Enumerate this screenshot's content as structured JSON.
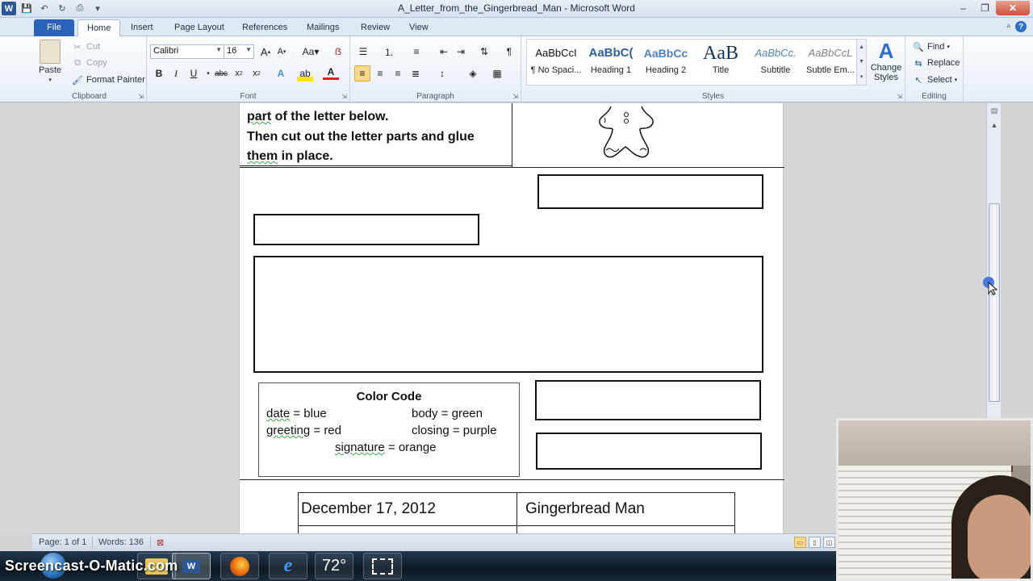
{
  "window": {
    "title": "A_Letter_from_the_Gingerbread_Man  -  Microsoft Word",
    "minimize": "–",
    "restore": "❐",
    "close": "✕"
  },
  "tabs": [
    "File",
    "Home",
    "Insert",
    "Page Layout",
    "References",
    "Mailings",
    "Review",
    "View"
  ],
  "active_tab": "Home",
  "clipboard": {
    "paste": "Paste",
    "cut": "Cut",
    "copy": "Copy",
    "format_painter": "Format Painter",
    "group_label": "Clipboard"
  },
  "font": {
    "name": "Calibri",
    "size": "16",
    "group_label": "Font"
  },
  "paragraph": {
    "group_label": "Paragraph"
  },
  "styles": {
    "items": [
      {
        "sample": "AaBbCcI",
        "name": "¶ No Spaci..."
      },
      {
        "sample": "AaBbC(",
        "name": "Heading 1"
      },
      {
        "sample": "AaBbCc",
        "name": "Heading 2"
      },
      {
        "sample": "AaB",
        "name": "Title"
      },
      {
        "sample": "AaBbCc.",
        "name": "Subtitle"
      },
      {
        "sample": "AaBbCcL",
        "name": "Subtle Em..."
      }
    ],
    "change_styles": "Change Styles",
    "group_label": "Styles"
  },
  "editing": {
    "find": "Find",
    "replace": "Replace",
    "select": "Select",
    "group_label": "Editing"
  },
  "document": {
    "instructions": {
      "line1_word": "part",
      "line1_rest": " of the letter below.",
      "line2": "Then cut out the letter parts and glue",
      "line3_word": "them",
      "line3_rest": " in place."
    },
    "color_code": {
      "title": "Color Code",
      "date_word": "date",
      "date_rest": " = blue",
      "body": "body = green",
      "greeting_word": "greeting",
      "greeting_rest": " = red",
      "closing": "closing = purple",
      "signature_word": "signature",
      "signature_rest": " = orange"
    },
    "table": {
      "date": "December  17, 2012",
      "greeting": "Gingerbread Man"
    }
  },
  "status": {
    "page": "Page: 1 of 1",
    "words": "Words: 136"
  },
  "taskbar": {
    "watermark": "Screencast-O-Matic.com",
    "temperature": "72°"
  },
  "colors": {
    "file_tab": "#2a62b8",
    "selection": "#fbd98a",
    "ink": "#111111"
  }
}
